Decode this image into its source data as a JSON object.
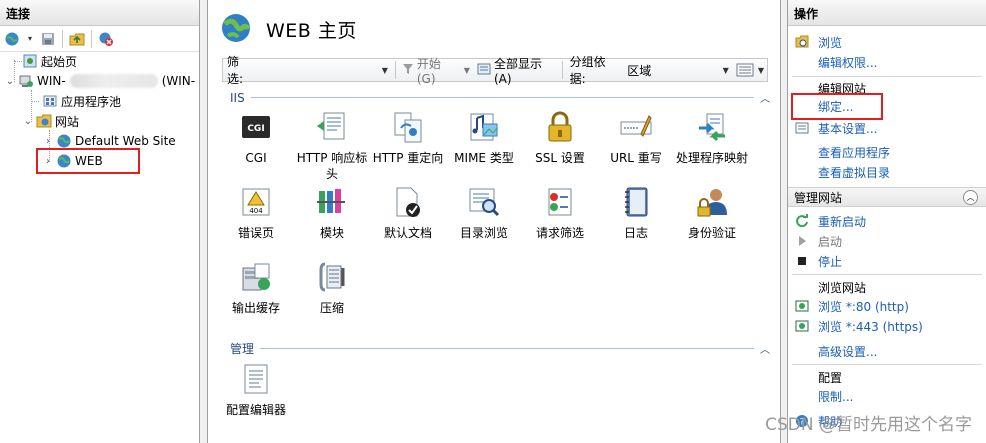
{
  "connections": {
    "header": "连接",
    "tree": {
      "start_page": "起始页",
      "server_prefix": "WIN-",
      "server_suffix": "(WIN-",
      "app_pools": "应用程序池",
      "sites": "网站",
      "default_site": "Default Web Site",
      "web_site": "WEB"
    }
  },
  "center": {
    "title": "WEB 主页",
    "filter": {
      "label": "筛选:",
      "value": "",
      "go_label": "开始(G)",
      "show_all_label": "全部显示(A)",
      "group_label": "分组依据:",
      "group_value": "区域"
    },
    "groups": [
      {
        "name": "IIS",
        "features": [
          {
            "label": "CGI",
            "icon": "cgi-icon"
          },
          {
            "label": "HTTP 响应标头",
            "icon": "http-response-headers-icon"
          },
          {
            "label": "HTTP 重定向",
            "icon": "http-redirect-icon"
          },
          {
            "label": "MIME 类型",
            "icon": "mime-types-icon"
          },
          {
            "label": "SSL 设置",
            "icon": "ssl-lock-icon"
          },
          {
            "label": "URL 重写",
            "icon": "url-rewrite-icon"
          },
          {
            "label": "处理程序映射",
            "icon": "handler-mappings-icon"
          },
          {
            "label": "错误页",
            "icon": "error-pages-icon"
          },
          {
            "label": "模块",
            "icon": "modules-icon"
          },
          {
            "label": "默认文档",
            "icon": "default-document-icon"
          },
          {
            "label": "目录浏览",
            "icon": "directory-browsing-icon"
          },
          {
            "label": "请求筛选",
            "icon": "request-filtering-icon"
          },
          {
            "label": "日志",
            "icon": "logging-icon"
          },
          {
            "label": "身份验证",
            "icon": "authentication-icon"
          },
          {
            "label": "输出缓存",
            "icon": "output-caching-icon"
          },
          {
            "label": "压缩",
            "icon": "compression-icon"
          }
        ]
      },
      {
        "name": "管理",
        "features": [
          {
            "label": "配置编辑器",
            "icon": "configuration-editor-icon"
          }
        ]
      }
    ]
  },
  "actions": {
    "header": "操作",
    "browse": "浏览",
    "edit_permissions": "编辑权限...",
    "edit_site_head": "编辑网站",
    "bindings": "绑定...",
    "basic_settings": "基本设置...",
    "view_applications": "查看应用程序",
    "view_virtual_dirs": "查看虚拟目录",
    "manage_site_head": "管理网站",
    "restart": "重新启动",
    "start": "启动",
    "stop": "停止",
    "browse_site_head": "浏览网站",
    "browse_80": "浏览 *:80 (http)",
    "browse_443": "浏览 *:443 (https)",
    "advanced_settings": "高级设置...",
    "config_head": "配置",
    "limits": "限制...",
    "help_prefix": "帮助"
  },
  "watermark": "CSDN @暂时先用这个名字",
  "colors": {
    "link": "#1a5fb4",
    "highlight_box": "#e02020"
  }
}
